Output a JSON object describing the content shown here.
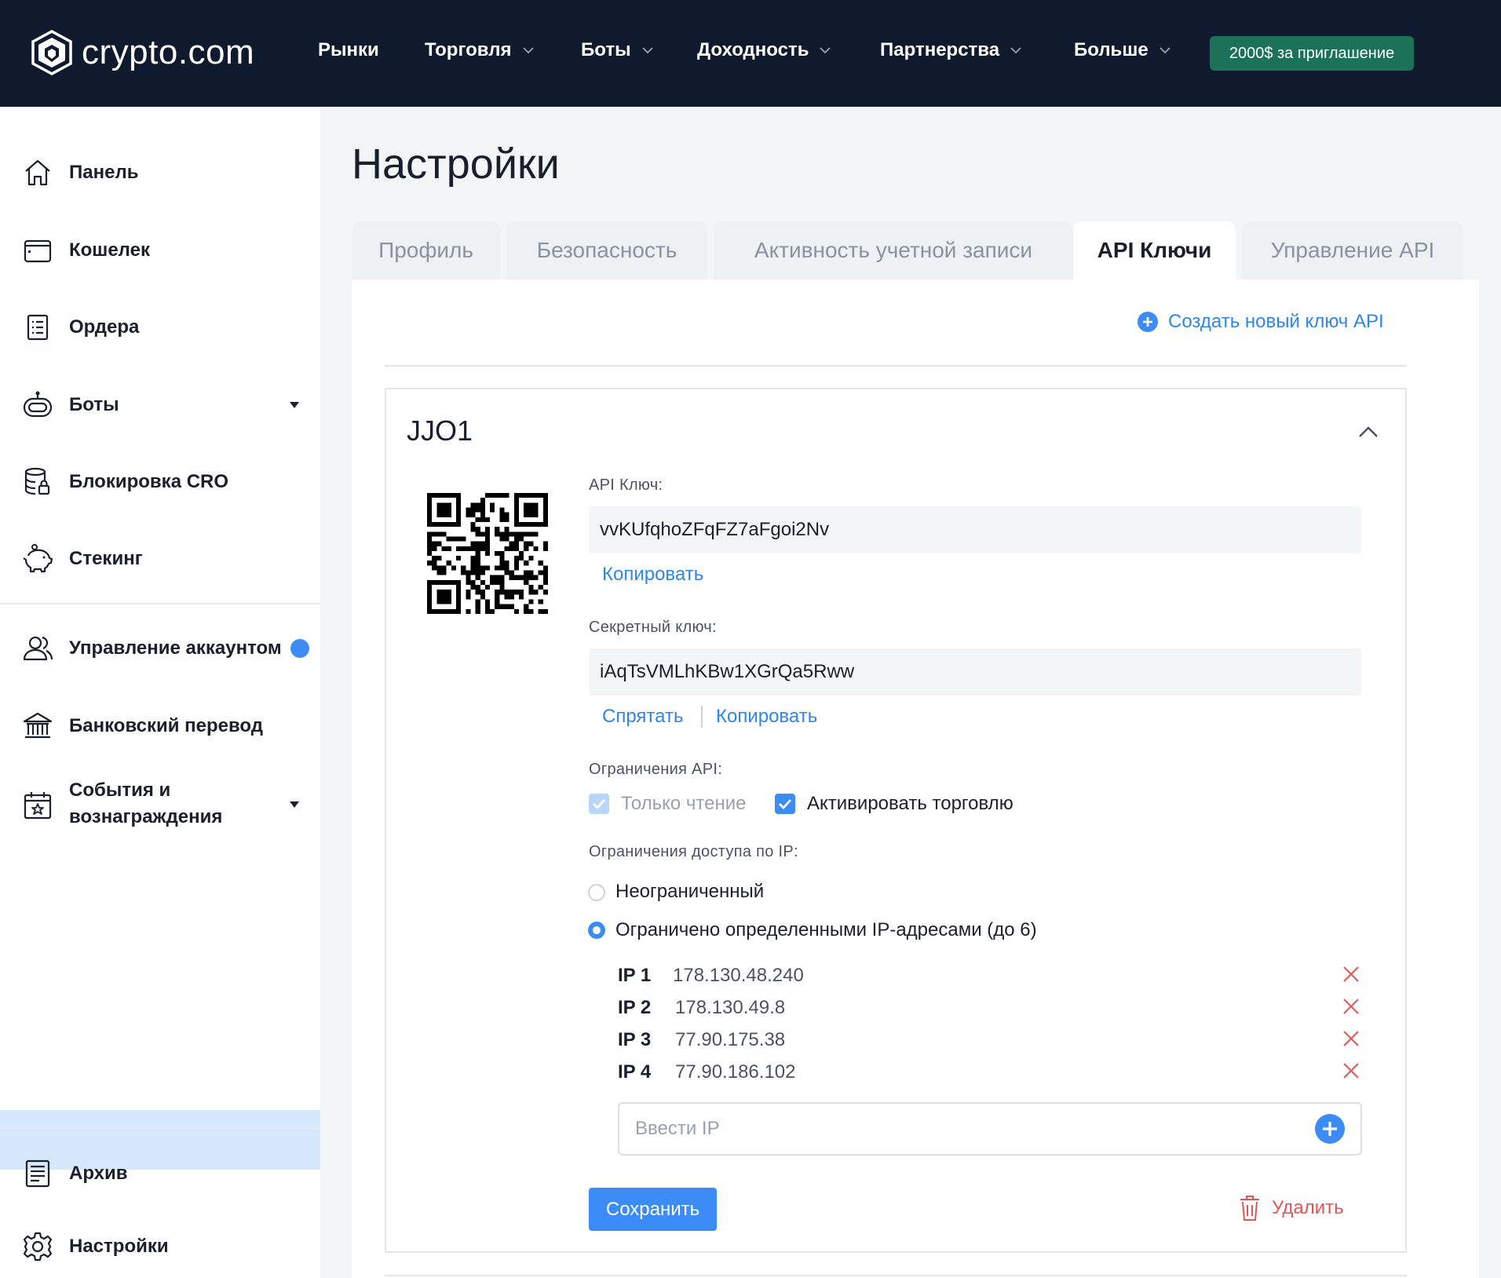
{
  "brand": {
    "name": "crypto.com"
  },
  "nav": {
    "items": [
      {
        "label": "Рынки",
        "has_dropdown": false
      },
      {
        "label": "Торговля",
        "has_dropdown": true
      },
      {
        "label": "Боты",
        "has_dropdown": true
      },
      {
        "label": "Доходность",
        "has_dropdown": true
      },
      {
        "label": "Партнерства",
        "has_dropdown": true
      },
      {
        "label": "Больше",
        "has_dropdown": true
      }
    ],
    "promo": "2000$ за приглашение"
  },
  "sidebar": {
    "items": [
      {
        "label": "Панель",
        "icon": "home-icon"
      },
      {
        "label": "Кошелек",
        "icon": "wallet-icon"
      },
      {
        "label": "Ордера",
        "icon": "orders-icon"
      },
      {
        "label": "Боты",
        "icon": "bot-icon",
        "has_dropdown": true
      },
      {
        "label": "Блокировка CRO",
        "icon": "database-lock-icon"
      },
      {
        "label": "Стекинг",
        "icon": "piggy-bank-icon"
      },
      {
        "label": "Управление аккаунтом",
        "icon": "users-icon",
        "has_notification": true
      },
      {
        "label": "Банковский перевод",
        "icon": "bank-icon"
      },
      {
        "label": "События и вознаграждения",
        "icon": "calendar-star-icon",
        "has_dropdown": true
      },
      {
        "label": "Архив",
        "icon": "archive-icon"
      },
      {
        "label": "Настройки",
        "icon": "gear-icon",
        "active": true
      }
    ]
  },
  "main": {
    "title": "Настройки",
    "tabs": [
      {
        "label": "Профиль",
        "active": false
      },
      {
        "label": "Безопасность",
        "active": false
      },
      {
        "label": "Активность учетной записи",
        "active": false
      },
      {
        "label": "API Ключи",
        "active": true
      },
      {
        "label": "Управление API",
        "active": false
      }
    ],
    "create_key_label": "Создать новый ключ API"
  },
  "api_key_card": {
    "name": "JJO1",
    "api_key_label": "API Ключ:",
    "api_key_value": "vvKUfqhoZFqFZ7aFgoi2Nv",
    "copy_label": "Копировать",
    "secret_label": "Секретный ключ:",
    "secret_value": "iAqTsVMLhKBw1XGrQa5Rww",
    "hide_label": "Спрятать",
    "copy_secret_label": "Копировать",
    "restrictions_label": "Ограничения API:",
    "permissions": [
      {
        "label": "Только чтение",
        "checked": true,
        "disabled": true
      },
      {
        "label": "Активировать торговлю",
        "checked": true,
        "disabled": false
      }
    ],
    "ip_restrictions_label": "Ограничения доступа по IP:",
    "ip_modes": [
      {
        "label": "Неограниченный",
        "selected": false
      },
      {
        "label": "Ограничено определенными IP-адресами (до 6)",
        "selected": true
      }
    ],
    "ips": [
      {
        "label": "IP 1",
        "value": "178.130.48.240"
      },
      {
        "label": "IP 2",
        "value": "178.130.49.8"
      },
      {
        "label": "IP 3",
        "value": "77.90.175.38"
      },
      {
        "label": "IP 4",
        "value": "77.90.186.102"
      }
    ],
    "ip_placeholder": "Ввести IP",
    "save_label": "Сохранить",
    "delete_label": "Удалить"
  },
  "colors": {
    "nav_bg": "#101a2e",
    "accent": "#3d8cf5",
    "link": "#2f86e8",
    "promo_bg": "#1c7256",
    "danger": "#e05656",
    "active_sidebar_bg": "#d6e8fb"
  }
}
